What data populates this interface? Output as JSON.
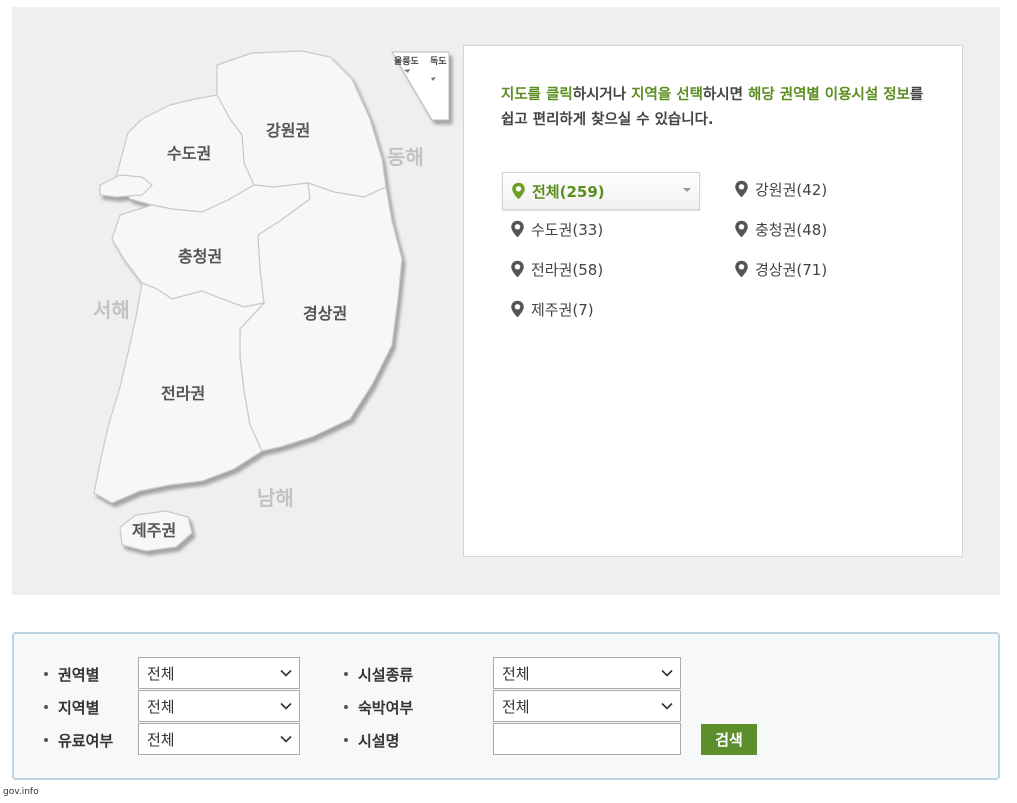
{
  "map": {
    "regions": {
      "gangwon": "강원권",
      "sudo": "수도권",
      "chungcheong": "충청권",
      "gyeongsang": "경상권",
      "jeolla": "전라권",
      "jeju": "제주권"
    },
    "seas": {
      "east": "동해",
      "west": "서해",
      "south": "남해"
    },
    "islands": {
      "ulleungdo": "울릉도",
      "dokdo": "독도"
    }
  },
  "info": {
    "p1": "지도를 클릭",
    "p2": "하시거나 ",
    "p3": "지역을 선택",
    "p4": "하시면 ",
    "p5": "해당 권역별 이용시설 정보",
    "p6": "를 쉽고 편리하게 찾으실 수 있습니다."
  },
  "region_list": [
    {
      "label": "전체(259)",
      "active": true
    },
    {
      "label": "강원권(42)"
    },
    {
      "label": "수도권(33)"
    },
    {
      "label": "충청권(48)"
    },
    {
      "label": "전라권(58)"
    },
    {
      "label": "경상권(71)"
    },
    {
      "label": "제주권(7)"
    }
  ],
  "search": {
    "region_label": "권역별",
    "region_value": "전체",
    "area_label": "지역별",
    "area_value": "전체",
    "paid_label": "유료여부",
    "paid_value": "전체",
    "facility_type_label": "시설종류",
    "facility_type_value": "전체",
    "lodging_label": "숙박여부",
    "lodging_value": "전체",
    "facility_name_label": "시설명",
    "facility_name_value": "",
    "button_label": "검색"
  },
  "footer": {
    "source": "gov.info"
  },
  "colors": {
    "accent_green": "#5b8d1f",
    "button_green": "#5c8f2c",
    "border_blue": "#bcd3e3"
  }
}
